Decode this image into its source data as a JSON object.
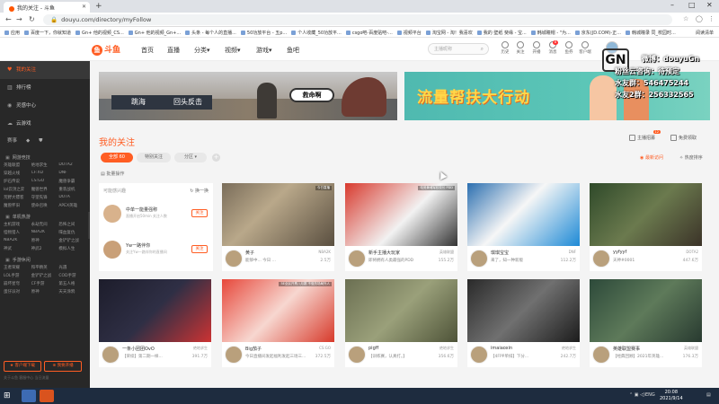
{
  "browser": {
    "tab_title": "我的关注 - 斗鱼",
    "url": "douyu.com/directory/myFollow",
    "new_tab": "+",
    "min": "–",
    "max": "□",
    "close": "✕"
  },
  "bookmarks": [
    "应用",
    "百度一下，你就知道",
    "Gn+ 他的视频_CS...",
    "Gn+ 他的视频_Gn+...",
    "头条 - 每个人的直播...",
    "50功放平台 - 五p...",
    "个人收藏_50功放平...",
    "csgo吧-百度贴吧-...",
    "视频平台",
    "淘宝网 - 淘！我喜欢",
    "我的 壁纸 斐缘 - 宝...",
    "韩城瞳帽 - \"为...",
    "京东(JD.COM)-正...",
    "韩城瞳录 同_校园时..."
  ],
  "bookmarks_right": "阅读清单",
  "header": {
    "logo": "斗鱼",
    "nav": [
      "首页",
      "直播",
      "分类▾",
      "视频▾",
      "游戏▾",
      "鱼吧"
    ],
    "search_placeholder": "主播昵称",
    "icons": [
      {
        "label": "历史"
      },
      {
        "label": "关注"
      },
      {
        "label": "开播"
      },
      {
        "label": "消息",
        "badge": "8"
      },
      {
        "label": "鱼券"
      },
      {
        "label": "客户端"
      }
    ]
  },
  "watermark": {
    "logo": "GN",
    "line1": "微博：douyuGn",
    "line2": "粉丝云咨询：待预定",
    "line3": "水友群：546475244",
    "line4": "水友2群：256332565"
  },
  "sidebar": {
    "items": [
      {
        "label": "我的关注",
        "icon": "♥"
      },
      {
        "label": "排行榜",
        "icon": "▥"
      },
      {
        "label": "灵感中心",
        "icon": "◉"
      },
      {
        "label": "云游戏",
        "icon": "☁"
      }
    ],
    "social": [
      "赛事",
      "◆",
      "⛊"
    ],
    "sections": [
      {
        "title": "网游竞技",
        "games": [
          "英雄联盟",
          "绝地求生",
          "DOTA2",
          "穿越火线",
          "CF:XD",
          "DNF",
          "炉石传说",
          "CS:GO",
          "魔兽争霸",
          "lol云顶之弈",
          "魔兽世界",
          "重装战机",
          "荒野大镖客",
          "守望先锋",
          "DOTA",
          "魔兽怀旧",
          "使命召唤",
          "APEX英雄"
        ]
      },
      {
        "title": "单机热游",
        "games": [
          "主机游戏",
          "永劫无间",
          "恐怖之间",
          "怪物猎人",
          "NBA2K",
          "喋血复仇",
          "NBA2K",
          "原神",
          "金铲铲之战",
          "神武",
          "神武2",
          "模拟人生"
        ]
      },
      {
        "title": "手游休闲",
        "games": [
          "王者荣耀",
          "和平精英",
          "光遇",
          "LOL手游",
          "金铲铲之战",
          "COD手游",
          "崩坏星穹",
          "CF手游",
          "第五人格",
          "蛋仔派对",
          "原神",
          "天天涂鸦"
        ]
      }
    ],
    "buttons": [
      "★ 客户端下载",
      "⊕ 我要开播"
    ],
    "footer": "关于斗鱼  客服中心  当日流量"
  },
  "banners": {
    "b1_p1": "跳海",
    "b1_p2": "回头反击",
    "b1_p3": "救命啊",
    "b2_text": "流量帮扶大行动"
  },
  "follow": {
    "title": "我的关注",
    "right_btns": [
      {
        "label": "主播招募",
        "badge": "12"
      },
      {
        "label": "免费领取"
      }
    ],
    "pills": [
      {
        "label": "全部 60",
        "on": true
      },
      {
        "label": "特别关注",
        "on": false
      },
      {
        "label": "分区 ▾",
        "on": false
      }
    ],
    "add": "+",
    "sort_1": "◉ 最新访问",
    "sort_2": "✧ 热度排序",
    "batch": "▤ 批量操作",
    "rec": {
      "header": "可能感兴趣",
      "switch": "↻ 换一换",
      "users": [
        {
          "name": "中单一能量强称",
          "desc": "直播开启50min 关注人数",
          "btn": "关注"
        },
        {
          "name": "Yw一路伴你",
          "desc": "关注Yw一路伴你的直播间",
          "btn": "关注"
        }
      ]
    }
  },
  "cards": [
    {
      "name": "黄子",
      "cat": "NBA2K",
      "title": "能够中... 今日 ...",
      "views": "2.5万",
      "tag": "今日直播"
    },
    {
      "name": "新手主播大玩家",
      "cat": "英雄联盟",
      "title": "即将拥有人类最强的PDD",
      "views": "155.2万",
      "tag": "电竞黄埔军校校长 PDD"
    },
    {
      "name": "琪琪宝宝",
      "cat": "DNF",
      "title": "来了，知一种新版",
      "views": "112.2万",
      "tag": ""
    },
    {
      "name": "yyfyyf",
      "cat": "DOTA2",
      "title": "天神#0001",
      "views": "447.6万",
      "tag": ""
    },
    {
      "name": "一条小团团OvO",
      "cat": "绝地求生",
      "title": "【荣续】第二期一样...",
      "views": "391.7万",
      "tag": ""
    },
    {
      "name": "Big茄子",
      "cat": "CS:GO",
      "title": "今日直播间发起福利发起三场三...",
      "views": "372.5万",
      "tag": "5E全民开黑八月赛 不做热场局外人"
    },
    {
      "name": "pigff",
      "cat": "绝地求生",
      "title": "【训练赛，认真打。】",
      "views": "356.6万",
      "tag": ""
    },
    {
      "name": "imaiaoxin",
      "cat": "绝地求生",
      "title": "【4FPP单排】下分...",
      "views": "242.7万",
      "tag": ""
    },
    {
      "name": "英雄联盟赛事",
      "cat": "英雄联盟",
      "title": "【经典回顾】2021年英雄...",
      "views": "176.3万",
      "tag": ""
    }
  ],
  "taskbar": {
    "start": "⊞",
    "tray_lang": "ENG",
    "time": "20:08",
    "date": "2021/9/14"
  }
}
